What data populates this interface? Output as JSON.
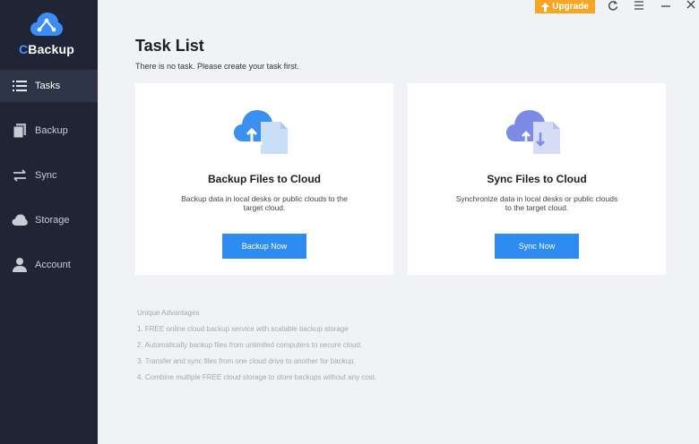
{
  "app": {
    "logo_text_c": "C",
    "logo_text_rest": "Backup"
  },
  "sidebar": {
    "items": [
      {
        "label": "Tasks",
        "icon": "list-icon",
        "active": true
      },
      {
        "label": "Backup",
        "icon": "copy-icon",
        "active": false
      },
      {
        "label": "Sync",
        "icon": "sync-arrows-icon",
        "active": false
      },
      {
        "label": "Storage",
        "icon": "cloud-icon",
        "active": false
      },
      {
        "label": "Account",
        "icon": "user-icon",
        "active": false
      }
    ]
  },
  "topbar": {
    "upgrade_label": "Upgrade",
    "icons": [
      "refresh-icon",
      "menu-icon",
      "minimize-icon",
      "close-icon"
    ]
  },
  "main": {
    "title": "Task List",
    "subtitle": "There is no task. Please create your task first.",
    "cards": [
      {
        "title": "Backup Files to Cloud",
        "desc": "Backup data in local desks or public clouds to the target cloud.",
        "button": "Backup Now",
        "icon": "cloud-upload-icon"
      },
      {
        "title": "Sync Files to Cloud",
        "desc": "Synchronize data in local desks or public clouds to the target cloud.",
        "button": "Sync Now",
        "icon": "cloud-sync-icon"
      }
    ],
    "advantages": {
      "heading": "Unique Advantages",
      "items": [
        "1. FREE online cloud backup service with scalable backup storage",
        "2. Automatically backup files from unlimited computers to secure cloud.",
        "3. Transfer and sync files from one cloud drive to another for backup.",
        "4. Combine multiple FREE cloud storage to store backups without any cost."
      ]
    }
  },
  "colors": {
    "sidebar_bg": "#1f2534",
    "accent": "#2e8cf0",
    "upgrade": "#f5a623",
    "content_bg": "#f0f2f5"
  }
}
